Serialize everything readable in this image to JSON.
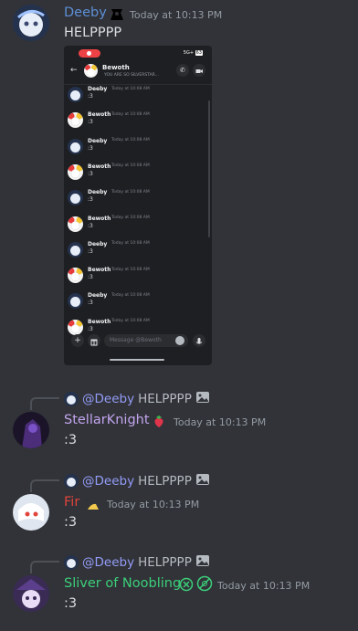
{
  "messages": [
    {
      "username": "Deeby",
      "username_color": "#5e8fd6",
      "timestamp": "Today at 10:13 PM",
      "content": "HELPPPP"
    },
    {
      "reply": {
        "mention": "@Deeby",
        "text": "HELPPPP"
      },
      "username": "StellarKnight",
      "username_color": "#c3a5ef",
      "timestamp": "Today at 10:13 PM",
      "content": ":3"
    },
    {
      "reply": {
        "mention": "@Deeby",
        "text": "HELPPPP"
      },
      "username": "Fir",
      "username_color": "#e0443b",
      "timestamp": "Today at 10:13 PM",
      "content": ":3"
    },
    {
      "reply": {
        "mention": "@Deeby",
        "text": "HELPPPP"
      },
      "username": "Sliver of Noobling",
      "username_color": "#3ccf7a",
      "timestamp": "Today at 10:13 PM",
      "content": ":3"
    }
  ],
  "phone": {
    "status": "5G+",
    "battery": "63",
    "chat_title": "Bewoth",
    "chat_subtitle": "YOU ARE SO SILVERSTAR...",
    "input_placeholder": "Message @Bewoth",
    "rows": [
      {
        "name": "Deeby",
        "time": "Today at 10:08 AM",
        "text": ":3"
      },
      {
        "name": "Bewoth",
        "time": "Today at 10:08 AM",
        "text": ":3"
      },
      {
        "name": "Deeby",
        "time": "Today at 10:08 AM",
        "text": ":3"
      },
      {
        "name": "Bewoth",
        "time": "Today at 10:08 AM",
        "text": ":3"
      },
      {
        "name": "Deeby",
        "time": "Today at 10:08 AM",
        "text": ":3"
      },
      {
        "name": "Bewoth",
        "time": "Today at 10:08 AM",
        "text": ":3"
      },
      {
        "name": "Deeby",
        "time": "Today at 10:08 AM",
        "text": ":3"
      },
      {
        "name": "Bewoth",
        "time": "Today at 10:08 AM",
        "text": ":3"
      },
      {
        "name": "Deeby",
        "time": "Today at 10:08 AM",
        "text": ":3"
      },
      {
        "name": "Bewoth",
        "time": "Today at 10:08 AM",
        "text": ":3"
      }
    ]
  }
}
